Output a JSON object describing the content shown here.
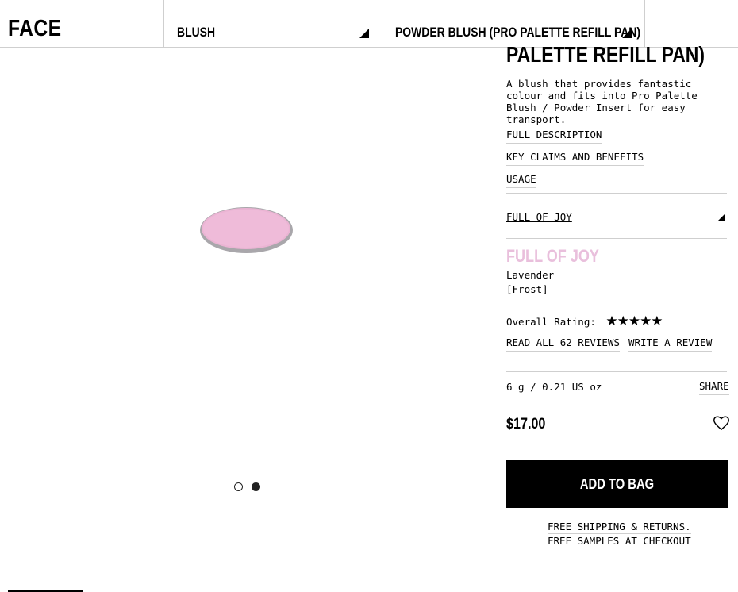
{
  "breadcrumb": {
    "category": "FACE",
    "subcategory": "BLUSH",
    "product": "POWDER BLUSH (PRO PALETTE REFILL PAN)"
  },
  "product": {
    "title_line": "PALETTE REFILL PAN)",
    "description": "A blush that provides fantastic colour and fits into Pro Palette Blush / Powder Insert for easy transport.",
    "links": [
      "FULL DESCRIPTION",
      "KEY CLAIMS AND BENEFITS",
      "USAGE"
    ],
    "shade_selector": "FULL OF JOY",
    "shade_name": "FULL OF JOY",
    "shade_color": "#e9bfdc",
    "shade_description": "Lavender",
    "finish": "[Frost]",
    "rating_label": "Overall Rating:",
    "rating_stars": "★★★★★",
    "rating_value": 5,
    "read_reviews": "READ ALL 62 REVIEWS",
    "write_review": "WRITE A REVIEW",
    "size": "6 g / 0.21 US oz",
    "share": "SHARE",
    "price": "$17.00",
    "add_to_bag": "ADD TO BAG",
    "shipping_line1": "FREE SHIPPING & RETURNS.",
    "shipping_line2": "FREE SAMPLES AT CHECKOUT"
  },
  "gallery": {
    "slides": 2,
    "active_slide": 2
  }
}
